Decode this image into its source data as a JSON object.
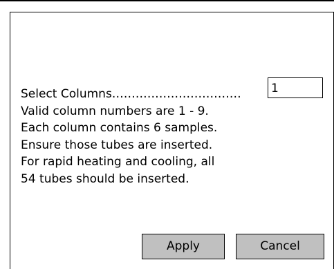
{
  "dialog": {
    "lines": [
      "Select Columns……………………………",
      "Valid column numbers are 1 - 9.",
      "Each column contains 6 samples.",
      "Ensure those tubes are inserted.",
      "For rapid heating and cooling, all",
      "54 tubes should be inserted."
    ],
    "columns_value": "1",
    "apply_label": "Apply",
    "cancel_label": "Cancel"
  }
}
